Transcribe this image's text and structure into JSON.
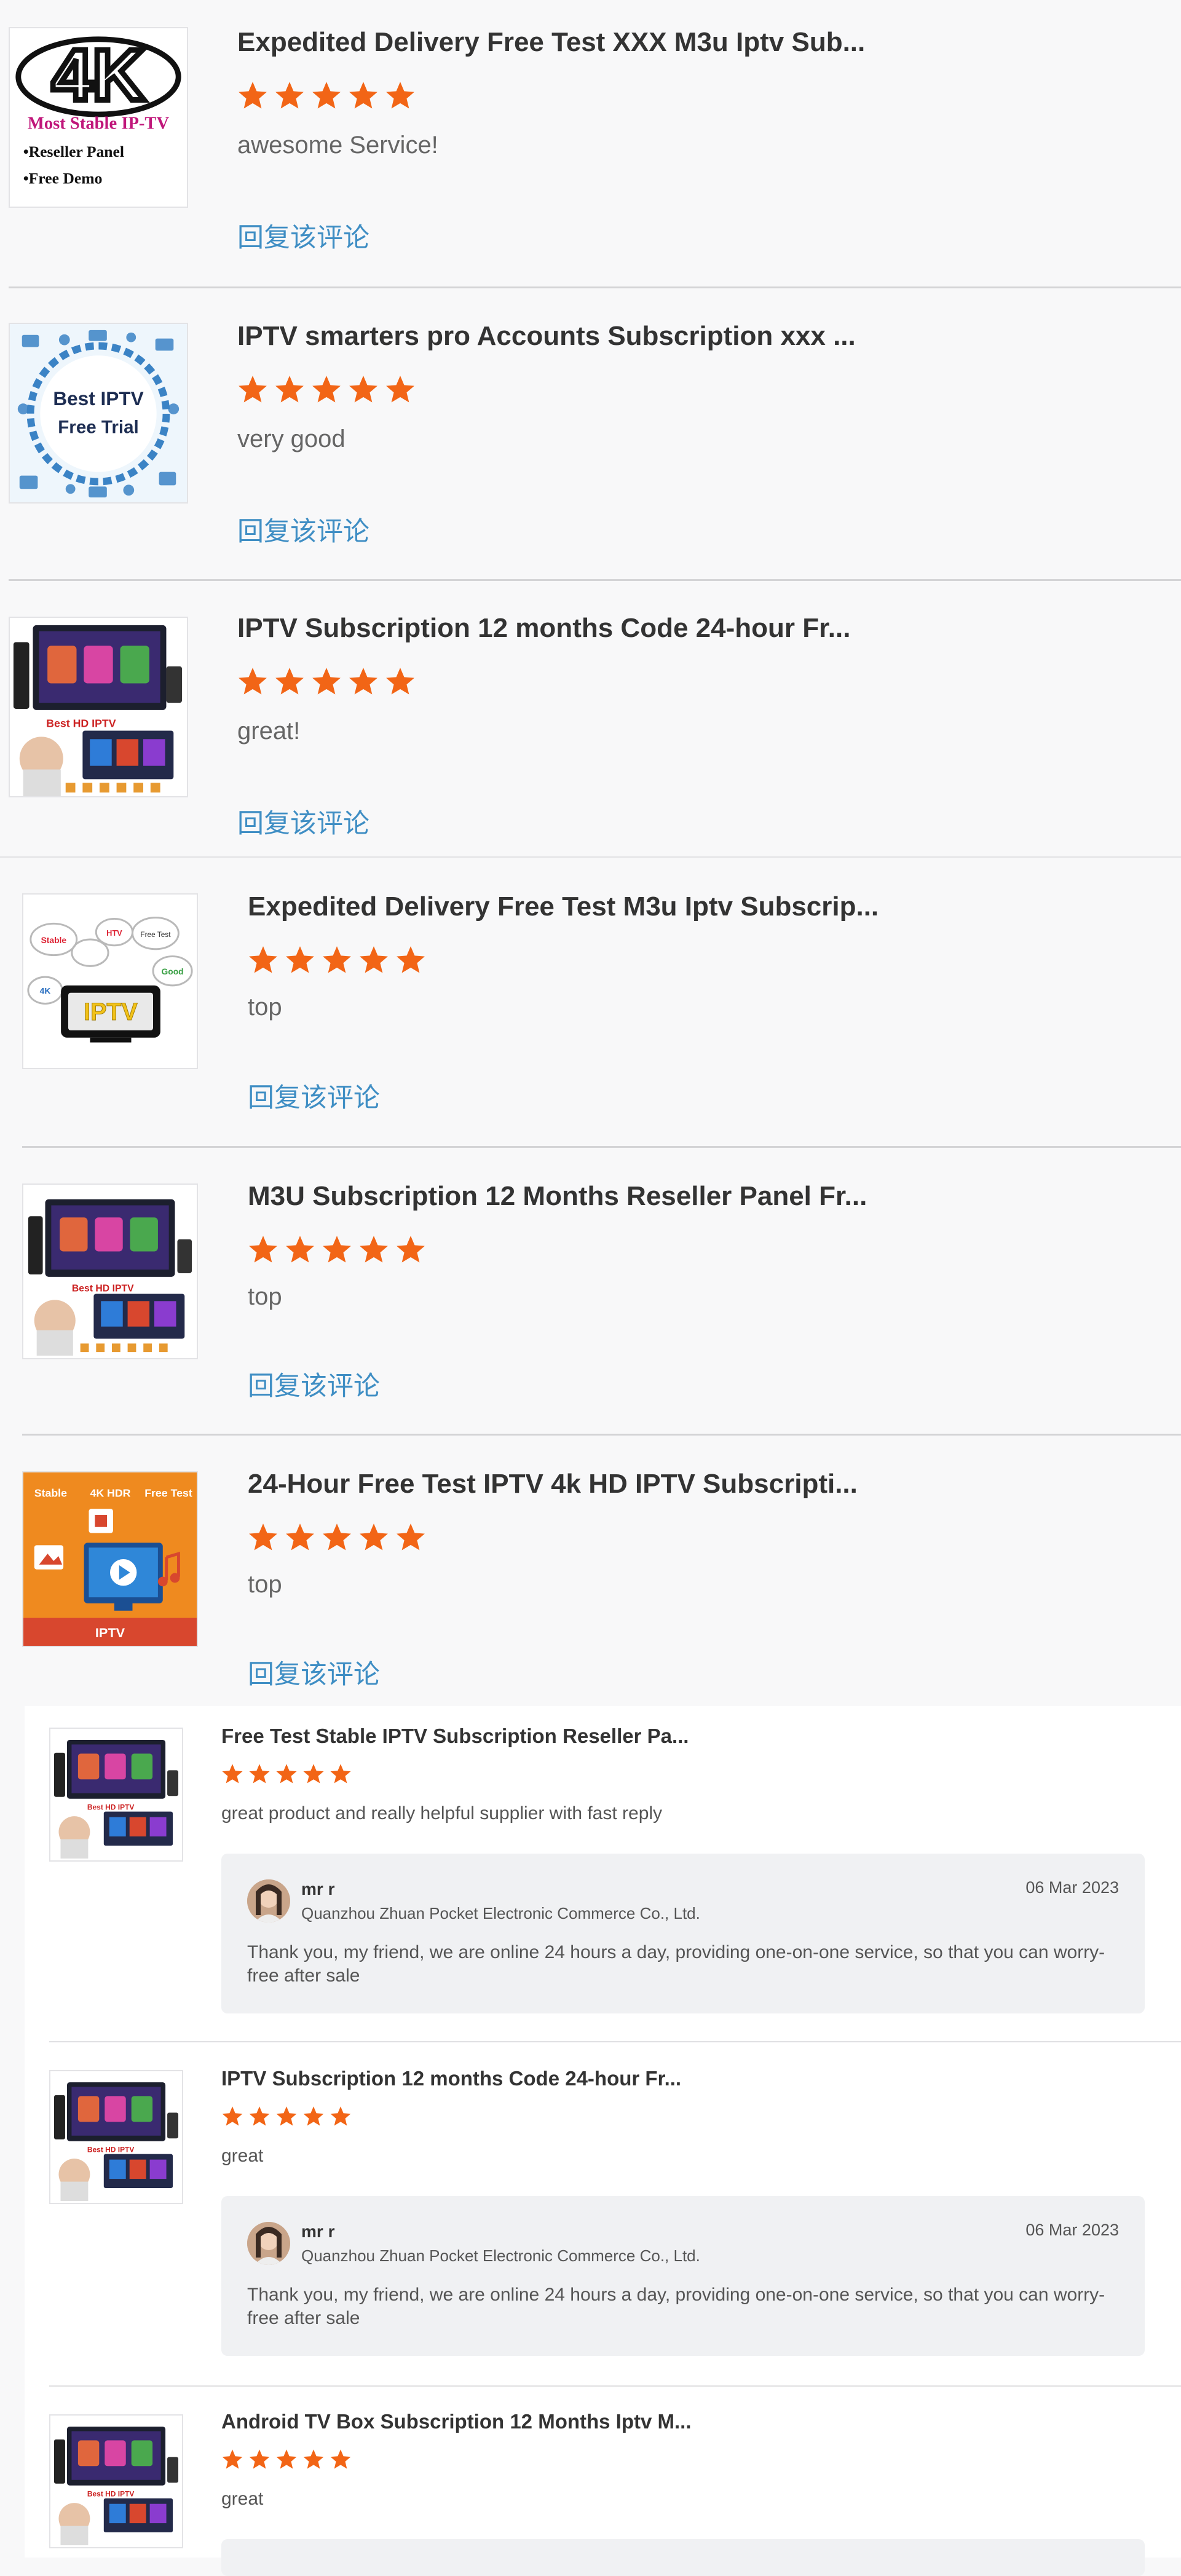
{
  "colors": {
    "star": "#f26516",
    "link": "#3f8ec4",
    "divider": "#d4d4d6"
  },
  "reply_link_label": "回复该评论",
  "reviews": [
    {
      "thumb_text": [
        "4K",
        "Most Stable IP-TV",
        "•Reseller Panel",
        "•Free Demo"
      ],
      "title": "Expedited Delivery Free Test XXX M3u Iptv Sub...",
      "rating": 5,
      "comment": "awesome Service!"
    },
    {
      "thumb_text": [
        "Best IPTV",
        "Free Trial"
      ],
      "title": "IPTV smarters pro Accounts Subscription xxx ...",
      "rating": 5,
      "comment": "very good"
    },
    {
      "thumb_text": [
        "Best HD IPTV"
      ],
      "title": "IPTV Subscription 12 months Code 24-hour Fr...",
      "rating": 5,
      "comment": "great!"
    },
    {
      "thumb_text": [
        "Stable",
        "HTV",
        "Free Test",
        "4K",
        "Good",
        "IPTV"
      ],
      "title": "Expedited Delivery Free Test M3u Iptv Subscrip...",
      "rating": 5,
      "comment": "top"
    },
    {
      "thumb_text": [
        "Best HD IPTV"
      ],
      "title": "M3U Subscription 12 Months Reseller Panel Fr...",
      "rating": 5,
      "comment": "top"
    },
    {
      "thumb_text": [
        "Stable",
        "4K HDR",
        "Free Test",
        "IPTV"
      ],
      "title": "24-Hour Free Test IPTV 4k HD IPTV Subscripti...",
      "rating": 5,
      "comment": "top"
    },
    {
      "thumb_text": [
        "Best HD IPTV"
      ],
      "title": "Free Test Stable IPTV Subscription Reseller Pa...",
      "rating": 5,
      "comment": "great product and really helpful supplier with fast reply",
      "reply": {
        "name": "mr r",
        "company": "Quanzhou Zhuan Pocket Electronic Commerce Co., Ltd.",
        "date": "06 Mar 2023",
        "text": "Thank you, my friend, we are online 24 hours a day, providing one-on-one service, so that you can worry-free after sale"
      }
    },
    {
      "thumb_text": [
        "Best HD IPTV"
      ],
      "title": "IPTV Subscription 12 months Code 24-hour Fr...",
      "rating": 5,
      "comment": "great",
      "reply": {
        "name": "mr r",
        "company": "Quanzhou Zhuan Pocket Electronic Commerce Co., Ltd.",
        "date": "06 Mar 2023",
        "text": "Thank you, my friend, we are online 24 hours a day, providing one-on-one service, so that you can worry-free after sale"
      }
    },
    {
      "thumb_text": [
        "Best HD IPTV"
      ],
      "title": "Android TV Box Subscription 12 Months Iptv M...",
      "rating": 5,
      "comment": "great"
    }
  ]
}
